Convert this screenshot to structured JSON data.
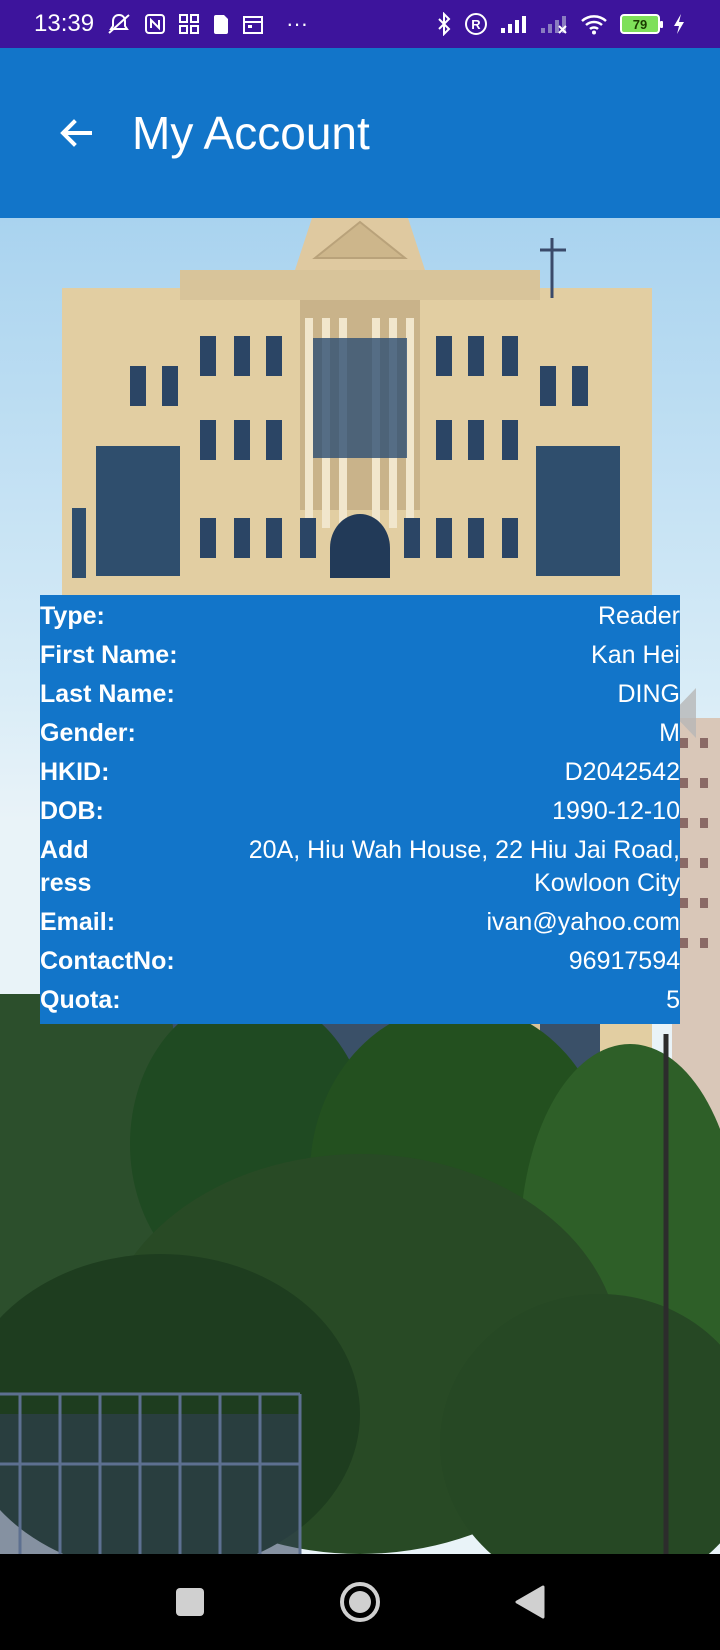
{
  "status_bar": {
    "time": "13:39",
    "more": "···",
    "battery_level": "79",
    "icons": [
      "silent-mode-icon",
      "nfc-icon",
      "app-grid-icon",
      "sim-card-icon",
      "calendar-icon",
      "bluetooth-icon",
      "registered-icon",
      "signal-icon",
      "signal-off-icon",
      "wifi-icon",
      "battery-icon",
      "charging-icon"
    ]
  },
  "app_bar": {
    "title": "My Account",
    "back_icon": "arrow-left-icon"
  },
  "account": {
    "rows": [
      {
        "label": "Type:",
        "value": "Reader"
      },
      {
        "label": "First Name:",
        "value": "Kan Hei"
      },
      {
        "label": "Last Name:",
        "value": "DING"
      },
      {
        "label": "Gender:",
        "value": "M"
      },
      {
        "label": "HKID:",
        "value": "D2042542"
      },
      {
        "label": "DOB:",
        "value": "1990-12-10"
      },
      {
        "label": "Add ress",
        "value": "20A, Hiu Wah House, 22 Hiu Jai Road, Kowloon City"
      },
      {
        "label": "Email:",
        "value": "ivan@yahoo.com"
      },
      {
        "label": "ContactNo:",
        "value": "96917594"
      },
      {
        "label": "Quota:",
        "value": "5"
      }
    ]
  },
  "nav_bar": {
    "icons": [
      "recents-square-icon",
      "home-circle-icon",
      "back-triangle-icon"
    ]
  },
  "colors": {
    "status_bar": "#3d149c",
    "app_bar": "#1275c9",
    "panel": "#1275c9"
  }
}
